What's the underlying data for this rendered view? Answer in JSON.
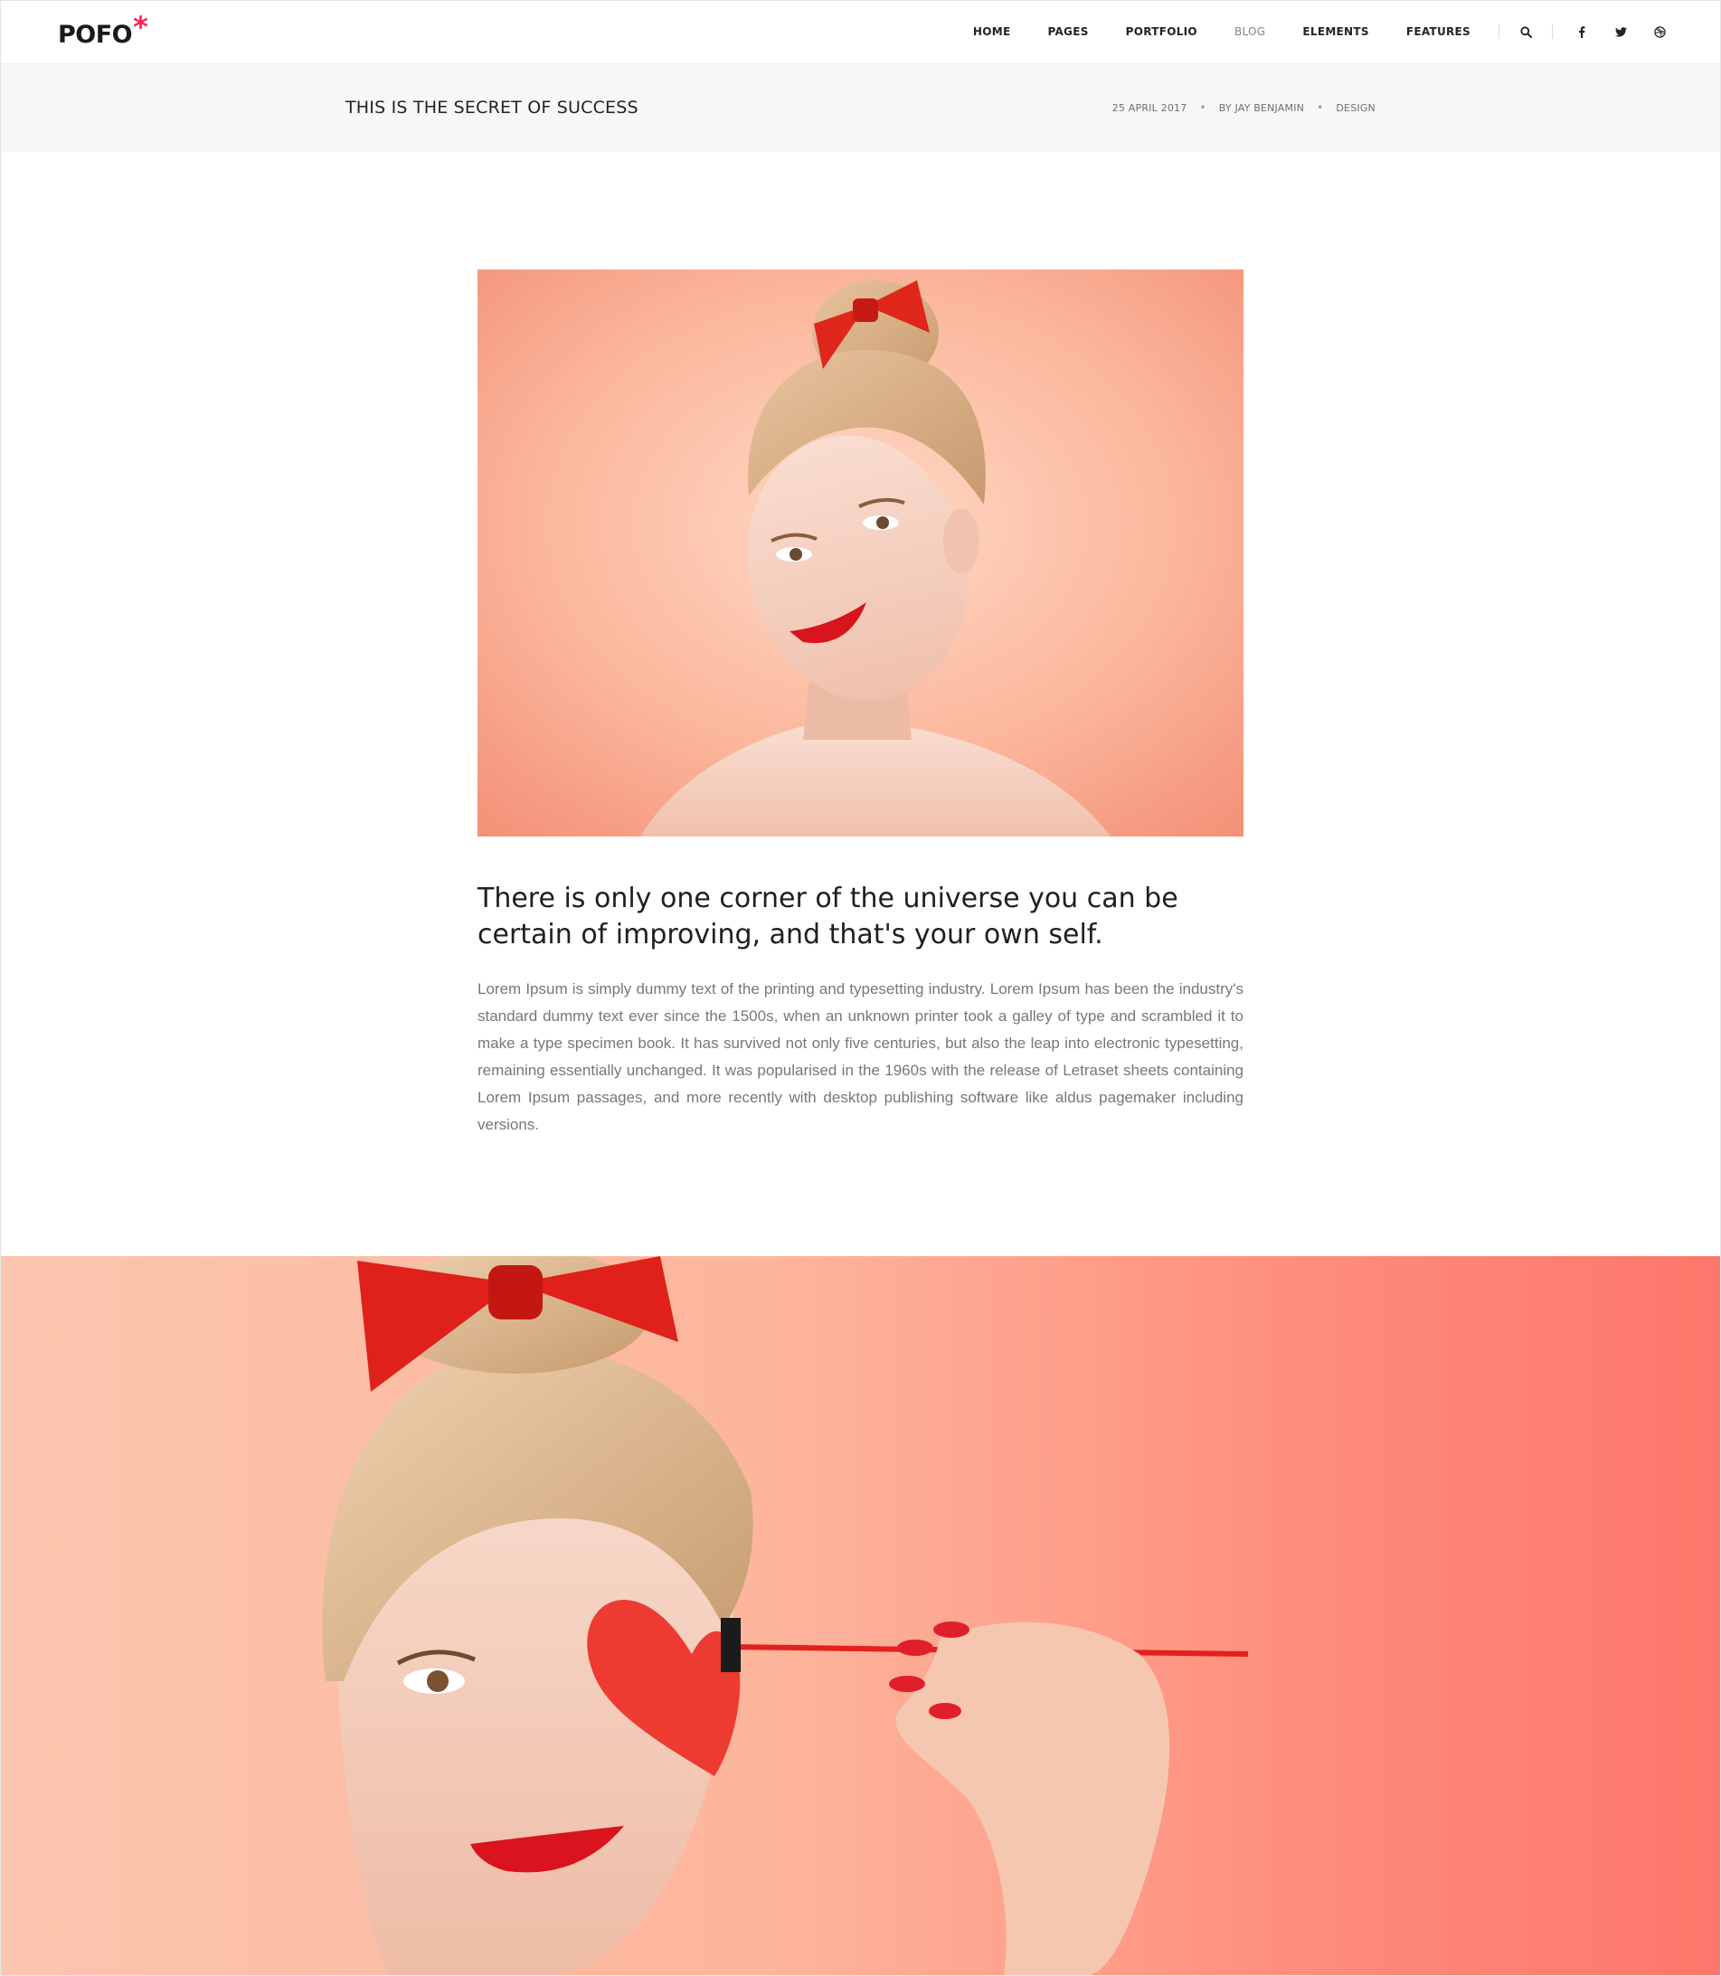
{
  "header": {
    "logo_text": "POFO",
    "logo_mark": "*",
    "nav": [
      {
        "label": "HOME"
      },
      {
        "label": "PAGES"
      },
      {
        "label": "PORTFOLIO"
      },
      {
        "label": "BLOG",
        "active": true
      },
      {
        "label": "ELEMENTS"
      },
      {
        "label": "FEATURES"
      }
    ],
    "icons": [
      "search-icon",
      "facebook-icon",
      "twitter-icon",
      "dribbble-icon"
    ]
  },
  "title_band": {
    "title": "THIS IS THE SECRET OF SUCCESS",
    "date": "25 APRIL 2017",
    "author": "BY JAY BENJAMIN",
    "category": "DESIGN",
    "separator": "•"
  },
  "article": {
    "quote": "There is only one corner of the universe you can be certain of improving, and that's your own self.",
    "body": "Lorem Ipsum is simply dummy text of the printing and typesetting industry. Lorem Ipsum has been the industry's standard dummy text ever since the 1500s, when an unknown printer took a galley of type and scrambled it to make a type specimen book. It has survived not only five centuries, but also the leap into electronic typesetting, remaining essentially unchanged. It was popularised in the 1960s with the release of Letraset sheets containing Lorem Ipsum passages, and more recently with desktop publishing software like aldus pagemaker including versions."
  },
  "colors": {
    "accent": "#ff214f",
    "title_band_bg": "#f7f7f7",
    "hero_bg": "#f6a488",
    "banner_bg_left": "#fcc7b0",
    "banner_bg_right": "#fe766b"
  }
}
